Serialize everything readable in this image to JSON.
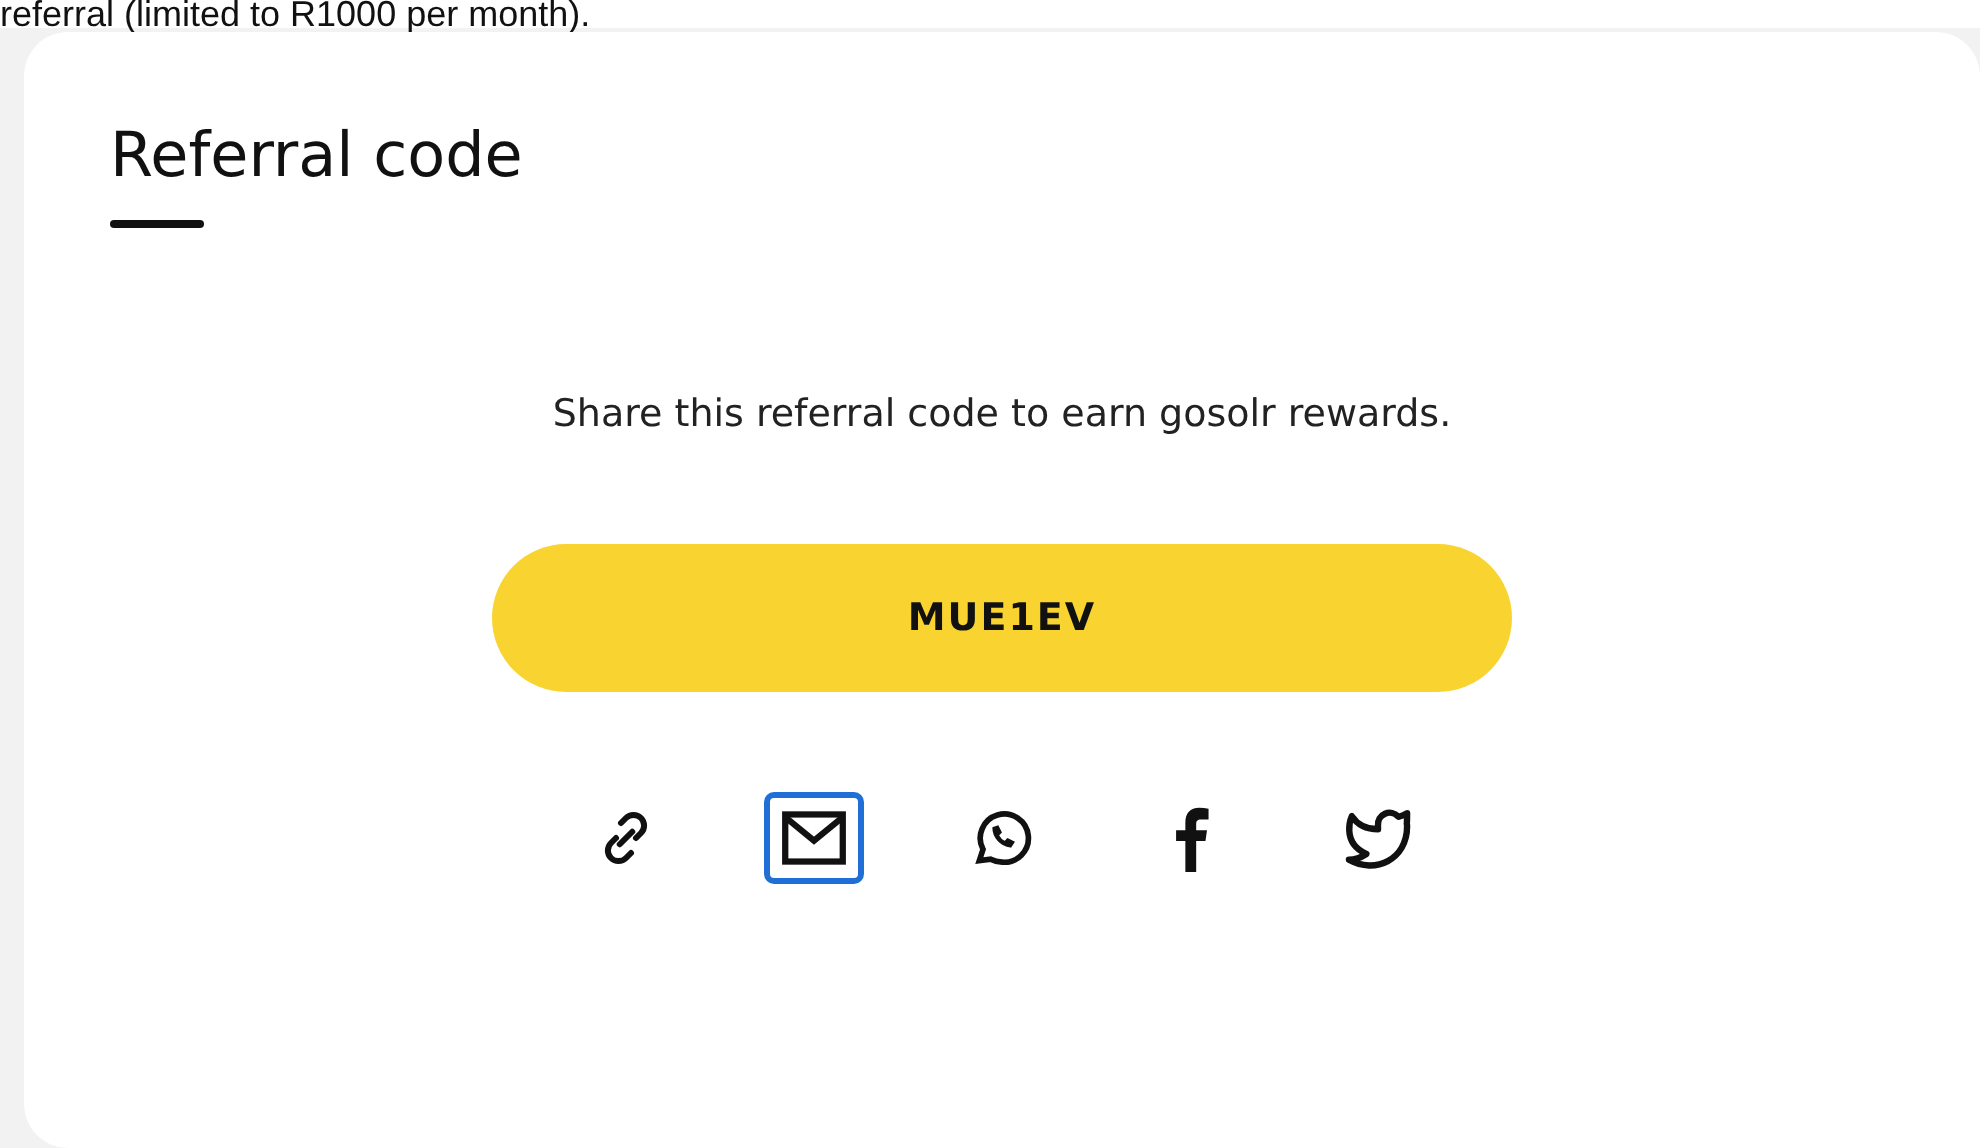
{
  "intro_text": "referral (limited to R1000 per month).",
  "card": {
    "title": "Referral code",
    "description": "Share this referral code to earn gosolr rewards.",
    "code": "MUE1EV",
    "share_options": [
      {
        "kind": "link",
        "selected": false
      },
      {
        "kind": "email",
        "selected": true
      },
      {
        "kind": "whatsapp",
        "selected": false
      },
      {
        "kind": "facebook",
        "selected": false
      },
      {
        "kind": "twitter",
        "selected": false
      }
    ]
  }
}
